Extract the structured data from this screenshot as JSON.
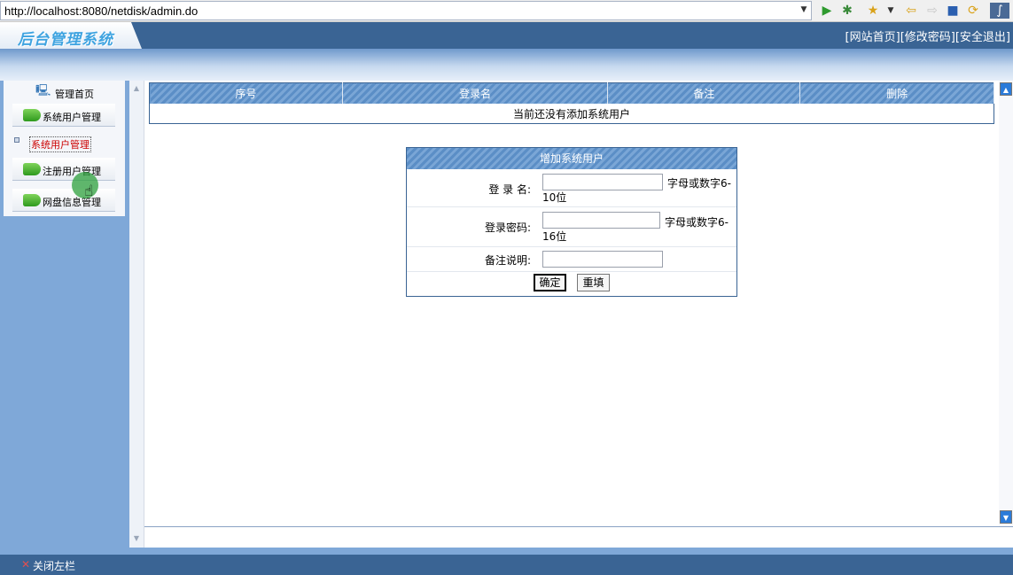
{
  "browser": {
    "url": "http://localhost:8080/netdisk/admin.do"
  },
  "header": {
    "logo": "后台管理系统",
    "links": [
      "[网站首页]",
      "[修改密码]",
      "[安全退出]"
    ]
  },
  "sidebar": {
    "home_label": "管理首页",
    "items": [
      {
        "label": "系统用户管理"
      },
      {
        "label": "系统用户管理",
        "selected": true
      },
      {
        "label": "注册用户管理"
      },
      {
        "label": "网盘信息管理"
      }
    ]
  },
  "users_table": {
    "columns": [
      "序号",
      "登录名",
      "备注",
      "删除"
    ],
    "empty_message": "当前还没有添加系统用户"
  },
  "add_form": {
    "title": "增加系统用户",
    "fields": [
      {
        "label": "登 录 名:",
        "value": "",
        "hint_line1": "字母或数字6-",
        "hint_line2": "10位"
      },
      {
        "label": "登录密码:",
        "value": "",
        "hint_line1": "字母或数字6-",
        "hint_line2": "16位"
      },
      {
        "label": "备注说明:",
        "value": ""
      }
    ],
    "submit_label": "确定",
    "reset_label": "重填"
  },
  "footer": {
    "close_label": "关闭左栏"
  }
}
